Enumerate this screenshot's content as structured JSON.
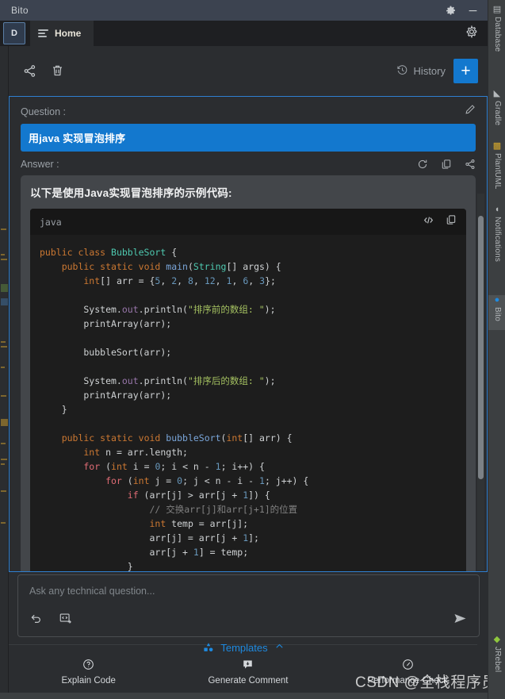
{
  "window": {
    "title": "Bito",
    "settings_icon": "gear-icon",
    "minimize_icon": "minimize-icon"
  },
  "tabbar": {
    "avatar_letter": "D",
    "home_label": "Home",
    "settings_icon": "gear-icon"
  },
  "toolbar": {
    "share_icon": "share-icon",
    "trash_icon": "trash-icon",
    "history_label": "History",
    "history_icon": "history-clock-icon",
    "new_chat_label": "+"
  },
  "chat": {
    "question_label": "Question :",
    "edit_icon": "pencil-icon",
    "question_text": "用java 实现冒泡排序",
    "answer_label": "Answer :",
    "answer_icons": [
      "refresh-icon",
      "copy-icon",
      "share-icon"
    ],
    "answer_text": "以下是使用Java实现冒泡排序的示例代码:",
    "code": {
      "language": "java",
      "insert_icon": "code-insert-icon",
      "copy_icon": "copy-icon",
      "lines": [
        [
          {
            "t": "public ",
            "c": "kw"
          },
          {
            "t": "class ",
            "c": "kw"
          },
          {
            "t": "BubbleSort",
            "c": "typ"
          },
          {
            "t": " {",
            "c": "pln"
          }
        ],
        [
          {
            "t": "    public ",
            "c": "kw"
          },
          {
            "t": "static ",
            "c": "kw"
          },
          {
            "t": "void ",
            "c": "kw"
          },
          {
            "t": "main",
            "c": "fn"
          },
          {
            "t": "(",
            "c": "pln"
          },
          {
            "t": "String",
            "c": "typ"
          },
          {
            "t": "[] args) {",
            "c": "pln"
          }
        ],
        [
          {
            "t": "        int",
            "c": "kw"
          },
          {
            "t": "[] arr = {",
            "c": "pln"
          },
          {
            "t": "5",
            "c": "num"
          },
          {
            "t": ", ",
            "c": "pln"
          },
          {
            "t": "2",
            "c": "num"
          },
          {
            "t": ", ",
            "c": "pln"
          },
          {
            "t": "8",
            "c": "num"
          },
          {
            "t": ", ",
            "c": "pln"
          },
          {
            "t": "12",
            "c": "num"
          },
          {
            "t": ", ",
            "c": "pln"
          },
          {
            "t": "1",
            "c": "num"
          },
          {
            "t": ", ",
            "c": "pln"
          },
          {
            "t": "6",
            "c": "num"
          },
          {
            "t": ", ",
            "c": "pln"
          },
          {
            "t": "3",
            "c": "num"
          },
          {
            "t": "};",
            "c": "pln"
          }
        ],
        [],
        [
          {
            "t": "        System.",
            "c": "pln"
          },
          {
            "t": "out",
            "c": "fld"
          },
          {
            "t": ".println(",
            "c": "pln"
          },
          {
            "t": "\"排序前的数组: \"",
            "c": "str"
          },
          {
            "t": ");",
            "c": "pln"
          }
        ],
        [
          {
            "t": "        printArray(arr);",
            "c": "pln"
          }
        ],
        [],
        [
          {
            "t": "        bubbleSort(arr);",
            "c": "pln"
          }
        ],
        [],
        [
          {
            "t": "        System.",
            "c": "pln"
          },
          {
            "t": "out",
            "c": "fld"
          },
          {
            "t": ".println(",
            "c": "pln"
          },
          {
            "t": "\"排序后的数组: \"",
            "c": "str"
          },
          {
            "t": ");",
            "c": "pln"
          }
        ],
        [
          {
            "t": "        printArray(arr);",
            "c": "pln"
          }
        ],
        [
          {
            "t": "    }",
            "c": "pln"
          }
        ],
        [],
        [
          {
            "t": "    public ",
            "c": "kw"
          },
          {
            "t": "static ",
            "c": "kw"
          },
          {
            "t": "void ",
            "c": "kw"
          },
          {
            "t": "bubbleSort",
            "c": "fn"
          },
          {
            "t": "(",
            "c": "pln"
          },
          {
            "t": "int",
            "c": "kw"
          },
          {
            "t": "[] arr) {",
            "c": "pln"
          }
        ],
        [
          {
            "t": "        int",
            "c": "kw"
          },
          {
            "t": " n = arr.length;",
            "c": "pln"
          }
        ],
        [
          {
            "t": "        for",
            "c": "kw2"
          },
          {
            "t": " (",
            "c": "pln"
          },
          {
            "t": "int",
            "c": "kw"
          },
          {
            "t": " i = ",
            "c": "pln"
          },
          {
            "t": "0",
            "c": "num"
          },
          {
            "t": "; i < n - ",
            "c": "pln"
          },
          {
            "t": "1",
            "c": "num"
          },
          {
            "t": "; i++) {",
            "c": "pln"
          }
        ],
        [
          {
            "t": "            for",
            "c": "kw2"
          },
          {
            "t": " (",
            "c": "pln"
          },
          {
            "t": "int",
            "c": "kw"
          },
          {
            "t": " j = ",
            "c": "pln"
          },
          {
            "t": "0",
            "c": "num"
          },
          {
            "t": "; j < n - i - ",
            "c": "pln"
          },
          {
            "t": "1",
            "c": "num"
          },
          {
            "t": "; j++) {",
            "c": "pln"
          }
        ],
        [
          {
            "t": "                if",
            "c": "kw2"
          },
          {
            "t": " (arr[j] > arr[j + ",
            "c": "pln"
          },
          {
            "t": "1",
            "c": "num"
          },
          {
            "t": "]) {",
            "c": "pln"
          }
        ],
        [
          {
            "t": "                    // 交换arr[j]和arr[j+1]的位置",
            "c": "cmt"
          }
        ],
        [
          {
            "t": "                    int",
            "c": "kw"
          },
          {
            "t": " temp = arr[j];",
            "c": "pln"
          }
        ],
        [
          {
            "t": "                    arr[j] = arr[j + ",
            "c": "pln"
          },
          {
            "t": "1",
            "c": "num"
          },
          {
            "t": "];",
            "c": "pln"
          }
        ],
        [
          {
            "t": "                    arr[j + ",
            "c": "pln"
          },
          {
            "t": "1",
            "c": "num"
          },
          {
            "t": "] = temp;",
            "c": "pln"
          }
        ],
        [
          {
            "t": "                }",
            "c": "pln"
          }
        ],
        [
          {
            "t": "            }",
            "c": "pln"
          }
        ]
      ]
    }
  },
  "ask": {
    "placeholder": "Ask any technical question...",
    "undo_icon": "undo-icon",
    "insert_code_icon": "insert-code-icon",
    "send_icon": "send-icon"
  },
  "footer": {
    "templates_label": "Templates",
    "templates_icon": "templates-icon",
    "chevron_icon": "chevron-up-icon",
    "actions": [
      {
        "label": "Explain Code",
        "icon": "question-circle-icon"
      },
      {
        "label": "Generate Comment",
        "icon": "comment-icon"
      },
      {
        "label": "Performance Check",
        "icon": "speedometer-icon"
      }
    ]
  },
  "right_sidebar": {
    "items": [
      {
        "label": "Database",
        "icon": "database-icon",
        "active": false
      },
      {
        "label": "Gradle",
        "icon": "gradle-elephant-icon",
        "active": false
      },
      {
        "label": "PlantUML",
        "icon": "plantuml-icon",
        "active": false
      },
      {
        "label": "Notifications",
        "icon": "bell-icon",
        "active": false
      },
      {
        "label": "Bito",
        "icon": "bito-icon",
        "active": true
      },
      {
        "label": "JRebel",
        "icon": "jrebel-icon",
        "active": false
      }
    ]
  },
  "watermark": {
    "text": "CSDN @全栈程序员"
  },
  "colors": {
    "accent_blue": "#1378ce",
    "titlebar": "#3c4350",
    "panel_bg": "#2b2d30",
    "code_bg": "#1d1d1d",
    "answer_bubble": "#43464a"
  }
}
